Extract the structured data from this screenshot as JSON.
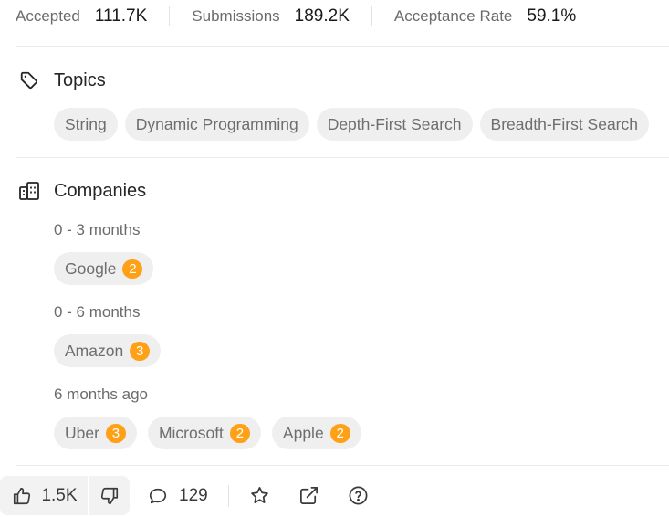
{
  "stats": [
    {
      "label": "Accepted",
      "value": "111.7K"
    },
    {
      "label": "Submissions",
      "value": "189.2K"
    },
    {
      "label": "Acceptance Rate",
      "value": "59.1%"
    }
  ],
  "topics": {
    "title": "Topics",
    "icon": "tag-icon",
    "items": [
      "String",
      "Dynamic Programming",
      "Depth-First Search",
      "Breadth-First Search"
    ]
  },
  "companies": {
    "title": "Companies",
    "icon": "building-icon",
    "groups": [
      {
        "period": "0 - 3 months",
        "items": [
          {
            "name": "Google",
            "count": "2"
          }
        ]
      },
      {
        "period": "0 - 6 months",
        "items": [
          {
            "name": "Amazon",
            "count": "3"
          }
        ]
      },
      {
        "period": "6 months ago",
        "items": [
          {
            "name": "Uber",
            "count": "3"
          },
          {
            "name": "Microsoft",
            "count": "2"
          },
          {
            "name": "Apple",
            "count": "2"
          }
        ]
      }
    ]
  },
  "footer": {
    "likes": "1.5K",
    "comments": "129",
    "icons": [
      "thumbs-up-icon",
      "thumbs-down-icon",
      "comment-icon",
      "star-icon",
      "external-link-icon",
      "help-icon"
    ]
  },
  "colors": {
    "badge": "#ffa116",
    "chip_bg": "#efefef",
    "divider": "#ebebeb"
  }
}
